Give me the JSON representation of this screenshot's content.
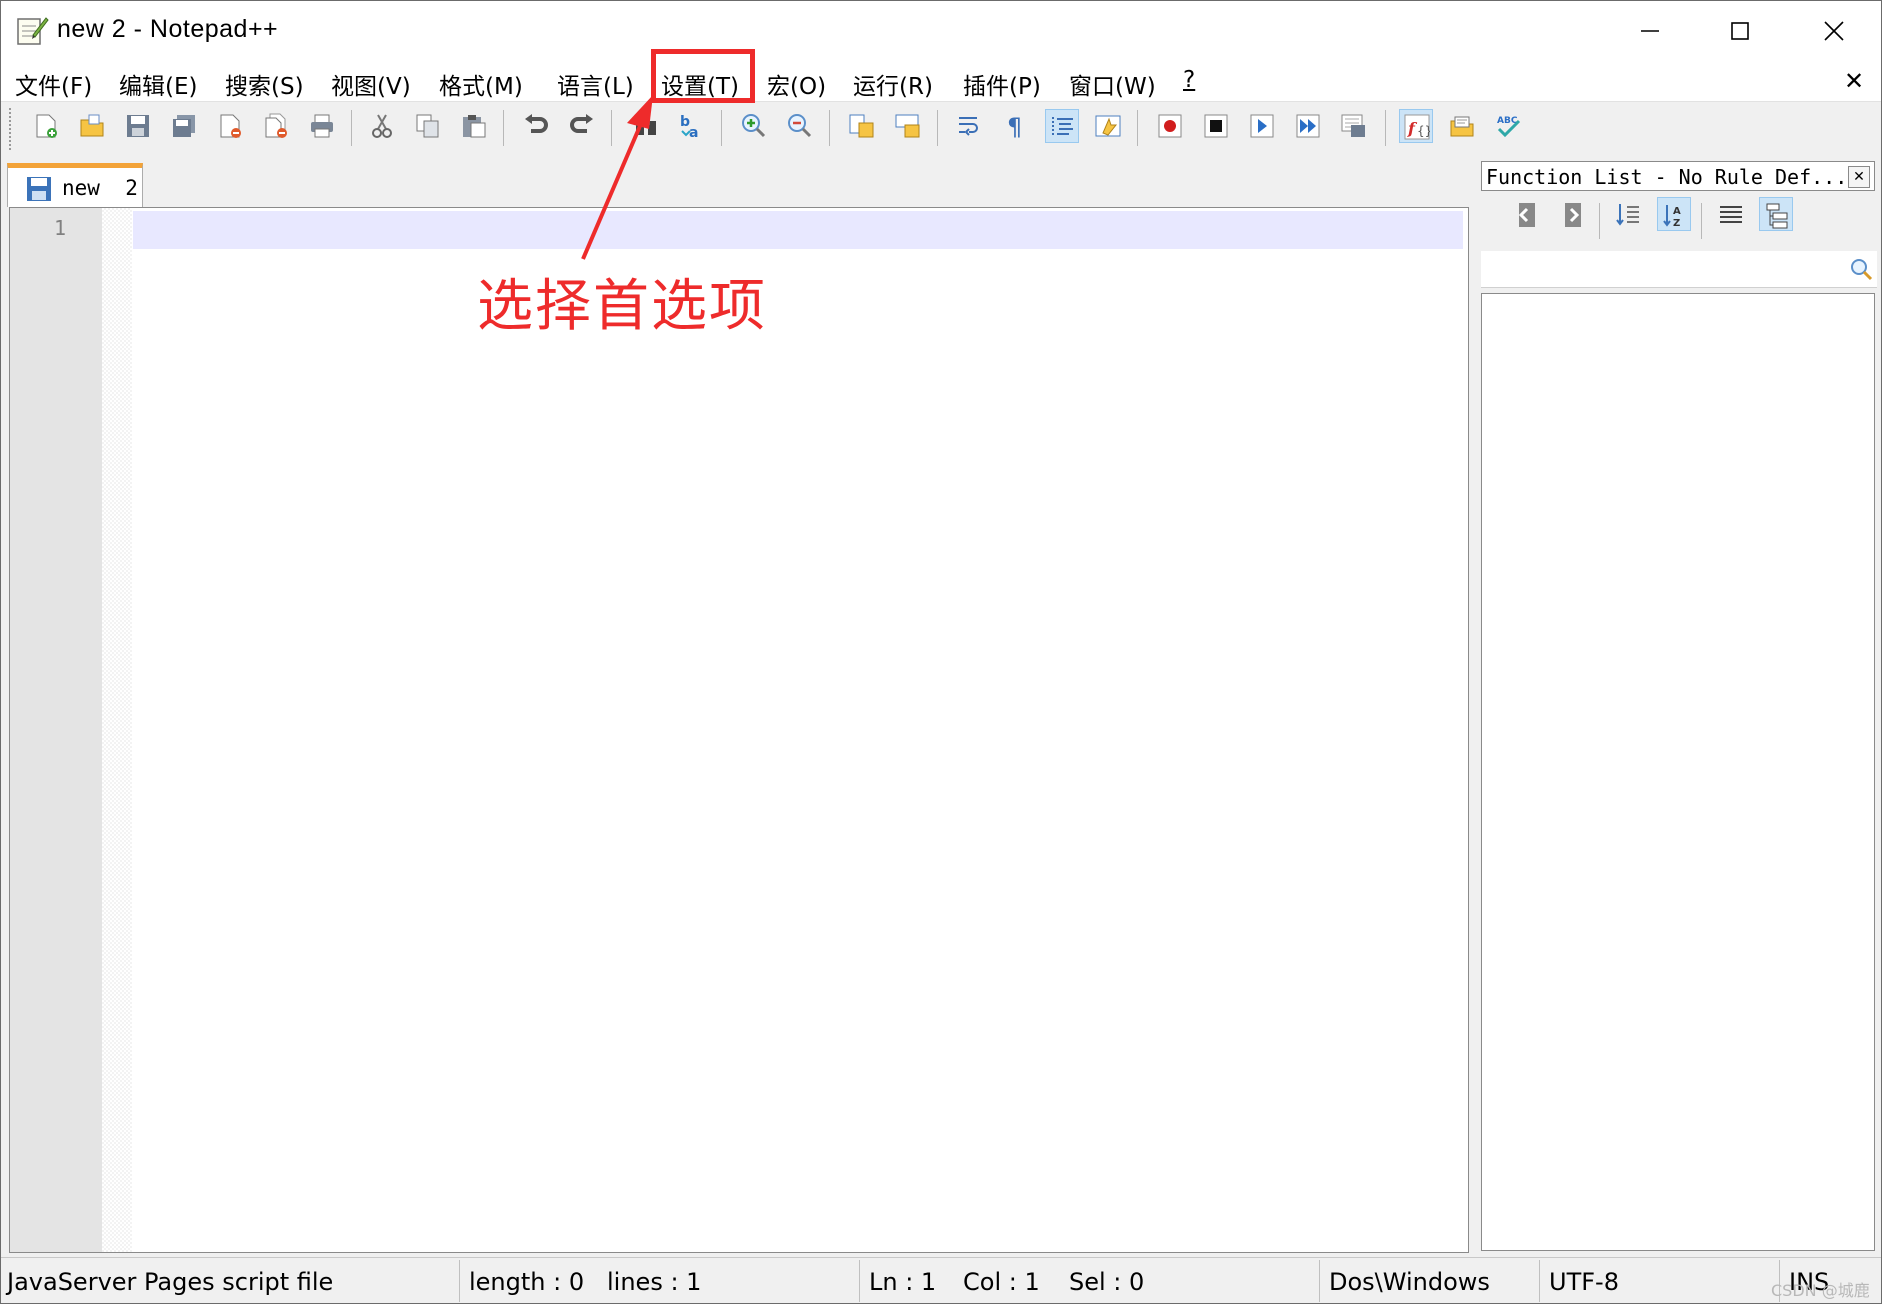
{
  "window": {
    "title": "new  2 - Notepad++",
    "controls": {
      "minimize": "—",
      "maximize": "☐",
      "close": "✕"
    }
  },
  "menu": {
    "items": [
      "文件(F)",
      "编辑(E)",
      "搜索(S)",
      "视图(V)",
      "格式(M)",
      "语言(L)",
      "设置(T)",
      "宏(O)",
      "运行(R)",
      "插件(P)",
      "窗口(W)",
      "?"
    ],
    "close_doc": "✕"
  },
  "toolbar": {
    "buttons": [
      "new-file",
      "open-file",
      "save",
      "save-all",
      "close",
      "close-all",
      "print",
      "cut",
      "copy",
      "paste",
      "undo",
      "redo",
      "find",
      "replace",
      "zoom-in",
      "zoom-out",
      "sync-vertical",
      "sync-horizontal",
      "word-wrap",
      "show-all-chars",
      "indent-guide",
      "folder-as-workspace",
      "record-macro",
      "stop-record",
      "play-macro",
      "run-macro-multiple",
      "save-macro",
      "function-list",
      "document-map",
      "spell-check"
    ]
  },
  "tabs": [
    {
      "label": "new  2",
      "active": true
    }
  ],
  "editor": {
    "line_numbers": [
      "1"
    ],
    "content": ""
  },
  "function_list": {
    "title": "Function List - No Rule Def...",
    "close": "✕",
    "search_value": ""
  },
  "status": {
    "file_type": "JavaServer Pages script file",
    "length": "length : 0",
    "lines": "lines : 1",
    "ln": "Ln : 1",
    "col": "Col : 1",
    "sel": "Sel : 0",
    "eol": "Dos\\Windows",
    "encoding": "UTF-8",
    "mode": "INS"
  },
  "annotation": {
    "text": "选择首选项",
    "color": "#ee2b2b"
  },
  "watermark": "CSDN @城鹿"
}
